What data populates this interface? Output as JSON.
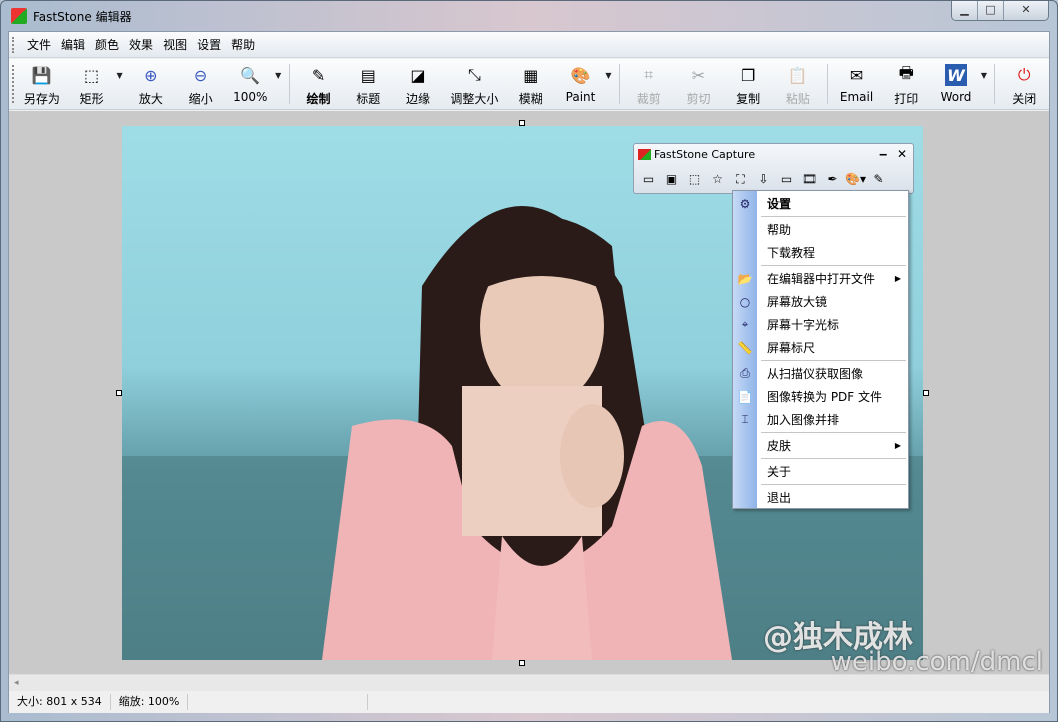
{
  "window": {
    "title": "FastStone 编辑器",
    "minimize": "▁",
    "maximize": "□",
    "close": "✕"
  },
  "menu": [
    "文件",
    "编辑",
    "颜色",
    "效果",
    "视图",
    "设置",
    "帮助"
  ],
  "toolbar": [
    {
      "label": "另存为",
      "icon": "save-icon",
      "glyph": "💾"
    },
    {
      "label": "矩形",
      "icon": "rect-select-icon",
      "glyph": "⬚",
      "dropdown": true
    },
    {
      "label": "放大",
      "icon": "zoom-in-icon",
      "glyph": "⊕"
    },
    {
      "label": "缩小",
      "icon": "zoom-out-icon",
      "glyph": "⊖"
    },
    {
      "label": "100%",
      "icon": "zoom-100-icon",
      "glyph": "🔍",
      "dropdown": true,
      "sepAfter": true
    },
    {
      "label": "绘制",
      "icon": "draw-icon",
      "glyph": "✎",
      "bold": true
    },
    {
      "label": "标题",
      "icon": "caption-icon",
      "glyph": "▤"
    },
    {
      "label": "边缘",
      "icon": "edge-icon",
      "glyph": "◪"
    },
    {
      "label": "调整大小",
      "icon": "resize-icon",
      "glyph": "⤡",
      "wide": true
    },
    {
      "label": "模糊",
      "icon": "blur-icon",
      "glyph": "▦"
    },
    {
      "label": "Paint",
      "icon": "paint-icon",
      "glyph": "🎨",
      "dropdown": true,
      "sepAfter": true
    },
    {
      "label": "裁剪",
      "icon": "crop-icon",
      "glyph": "⌗",
      "disabled": true
    },
    {
      "label": "剪切",
      "icon": "cut-icon",
      "glyph": "✂",
      "disabled": true
    },
    {
      "label": "复制",
      "icon": "copy-icon",
      "glyph": "❐"
    },
    {
      "label": "粘贴",
      "icon": "paste-icon",
      "glyph": "📋",
      "disabled": true,
      "sepAfter": true
    },
    {
      "label": "Email",
      "icon": "email-icon",
      "glyph": "✉"
    },
    {
      "label": "打印",
      "icon": "print-icon",
      "glyph": "🖶"
    },
    {
      "label": "Word",
      "icon": "word-icon",
      "glyph": "W",
      "dropdown": true,
      "sepAfter": true
    },
    {
      "label": "关闭",
      "icon": "power-icon",
      "glyph": "⏻"
    }
  ],
  "status": {
    "size": "大小: 801 x 534",
    "zoom": "缩放: 100%"
  },
  "capture": {
    "title": "FastStone Capture",
    "minimize": "‒",
    "close": "✕",
    "tools": [
      {
        "icon": "capture-window-icon",
        "glyph": "▭"
      },
      {
        "icon": "capture-object-icon",
        "glyph": "▣"
      },
      {
        "icon": "capture-rect-icon",
        "glyph": "⬚"
      },
      {
        "icon": "capture-freehand-icon",
        "glyph": "☆"
      },
      {
        "icon": "capture-fullscreen-icon",
        "glyph": "⛶"
      },
      {
        "icon": "capture-scroll-icon",
        "glyph": "⇩"
      },
      {
        "icon": "capture-fixed-icon",
        "glyph": "▭"
      },
      {
        "icon": "capture-video-icon",
        "glyph": "🎞"
      },
      {
        "icon": "color-picker-icon",
        "glyph": "✒"
      },
      {
        "icon": "output-icon",
        "glyph": "🎨▾"
      },
      {
        "icon": "settings-menu-icon",
        "glyph": "✎"
      }
    ]
  },
  "context_menu": [
    {
      "label": "设置",
      "icon": "gear-icon",
      "glyph": "⚙",
      "bold": true,
      "sepAfter": true
    },
    {
      "label": "帮助"
    },
    {
      "label": "下载教程",
      "sepAfter": true
    },
    {
      "label": "在编辑器中打开文件",
      "icon": "folder-open-icon",
      "glyph": "📂",
      "submenu": true
    },
    {
      "label": "屏幕放大镜",
      "icon": "magnifier-icon",
      "glyph": "○"
    },
    {
      "label": "屏幕十字光标",
      "icon": "crosshair-icon",
      "glyph": "⌖"
    },
    {
      "label": "屏幕标尺",
      "icon": "ruler-icon",
      "glyph": "📏",
      "sepAfter": true
    },
    {
      "label": "从扫描仪获取图像",
      "icon": "scanner-icon",
      "glyph": "⎙"
    },
    {
      "label": "图像转换为 PDF 文件",
      "icon": "pdf-icon",
      "glyph": "📄"
    },
    {
      "label": "加入图像并排",
      "icon": "join-images-icon",
      "glyph": "⌶",
      "sepAfter": true
    },
    {
      "label": "皮肤",
      "submenu": true,
      "sepAfter": true
    },
    {
      "label": "关于",
      "sepAfter": true
    },
    {
      "label": "退出"
    }
  ],
  "watermark": {
    "line1": "@独木成林",
    "line2": "weibo.com/dmcl"
  },
  "colors": {
    "accent": "#8fb3e8",
    "canvas": "#c9c9c9"
  }
}
